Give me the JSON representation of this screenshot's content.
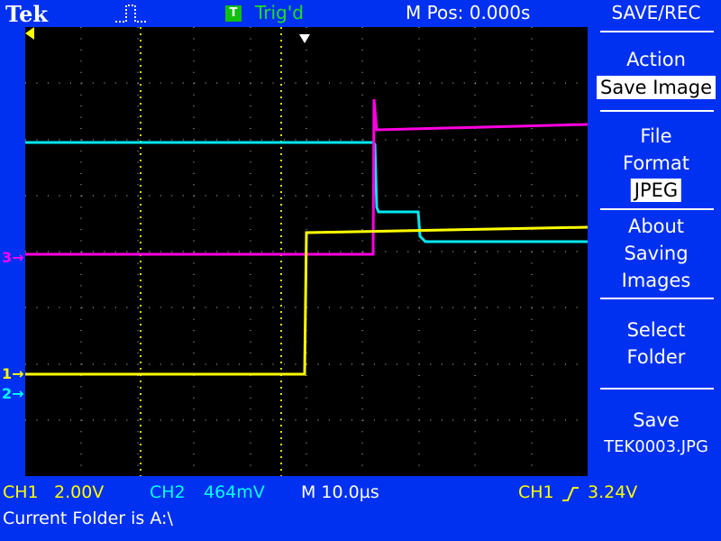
{
  "header": {
    "brand": "Tek",
    "trigger_status_badge": "T",
    "trigger_status": "Trig'd",
    "m_pos": "M Pos: 0.000s"
  },
  "menu": {
    "title": "SAVE/REC",
    "action_label": "Action",
    "action_value": "Save Image",
    "file_format_label_line1": "File",
    "file_format_label_line2": "Format",
    "file_format_value": "JPEG",
    "about_line1": "About",
    "about_line2": "Saving",
    "about_line3": "Images",
    "select_folder_line1": "Select",
    "select_folder_line2": "Folder",
    "save_line1": "Save",
    "save_line2": "TEK0003.JPG"
  },
  "channel_markers": {
    "ch1": "1",
    "ch2": "2",
    "ch3": "3"
  },
  "status": {
    "ch1_label": "CH1",
    "ch1_scale": "2.00V",
    "ch2_label": "CH2",
    "ch2_scale": "464mV",
    "timebase": "M 10.0µs",
    "trigger_source": "CH1",
    "trigger_level": "3.24V",
    "current_folder": "Current Folder is A:\\"
  },
  "colors": {
    "ch1": "#ffff00",
    "ch2": "#00ffff",
    "ch3": "#ff00ff",
    "background": "#0030f0",
    "screen": "#000000"
  }
}
